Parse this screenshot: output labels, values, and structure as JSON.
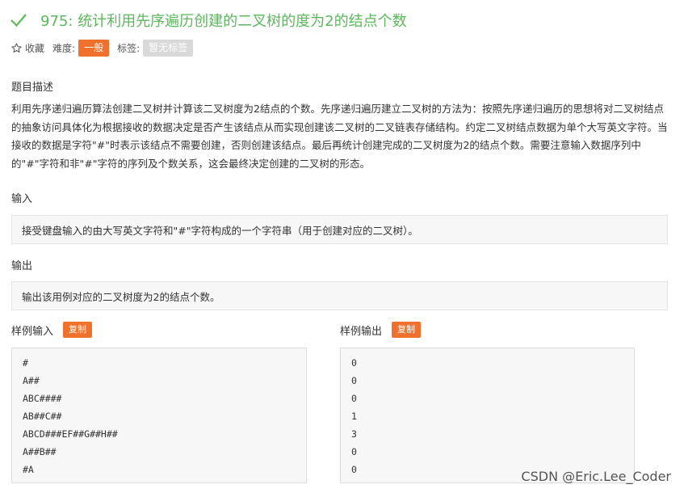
{
  "problem": {
    "title": "975: 统计利用先序遍历创建的二叉树的度为2的结点个数",
    "status_icon": "check-icon",
    "accent_color": "#5cb85c"
  },
  "meta": {
    "favorite_label": "收藏",
    "difficulty_label": "难度:",
    "difficulty_value": "一般",
    "tags_label": "标签:",
    "tags_value": "暂无标签"
  },
  "description": {
    "heading": "题目描述",
    "text": "利用先序递归遍历算法创建二叉树并计算该二叉树度为2结点的个数。先序递归遍历建立二叉树的方法为：按照先序递归遍历的思想将对二叉树结点的抽象访问具体化为根据接收的数据决定是否产生该结点从而实现创建该二叉树的二叉链表存储结构。约定二叉树结点数据为单个大写英文字符。当接收的数据是字符\"#\"时表示该结点不需要创建，否则创建该结点。最后再统计创建完成的二叉树度为2的结点个数。需要注意输入数据序列中的\"#\"字符和非\"#\"字符的序列及个数关系，这会最终决定创建的二叉树的形态。"
  },
  "input": {
    "heading": "输入",
    "text": "接受键盘输入的由大写英文字符和\"#\"字符构成的一个字符串（用于创建对应的二叉树）。"
  },
  "output": {
    "heading": "输出",
    "text": "输出该用例对应的二叉树度为2的结点个数。"
  },
  "sample_input": {
    "heading": "样例输入",
    "copy_label": "复制",
    "lines": [
      "#",
      "A##",
      "ABC####",
      "AB##C##",
      "ABCD###EF##G##H##",
      "A##B##",
      "#A"
    ]
  },
  "sample_output": {
    "heading": "样例输出",
    "copy_label": "复制",
    "lines": [
      "0",
      "0",
      "0",
      "1",
      "3",
      "0",
      "0"
    ]
  },
  "watermark": "CSDN @Eric.Lee_Coder"
}
